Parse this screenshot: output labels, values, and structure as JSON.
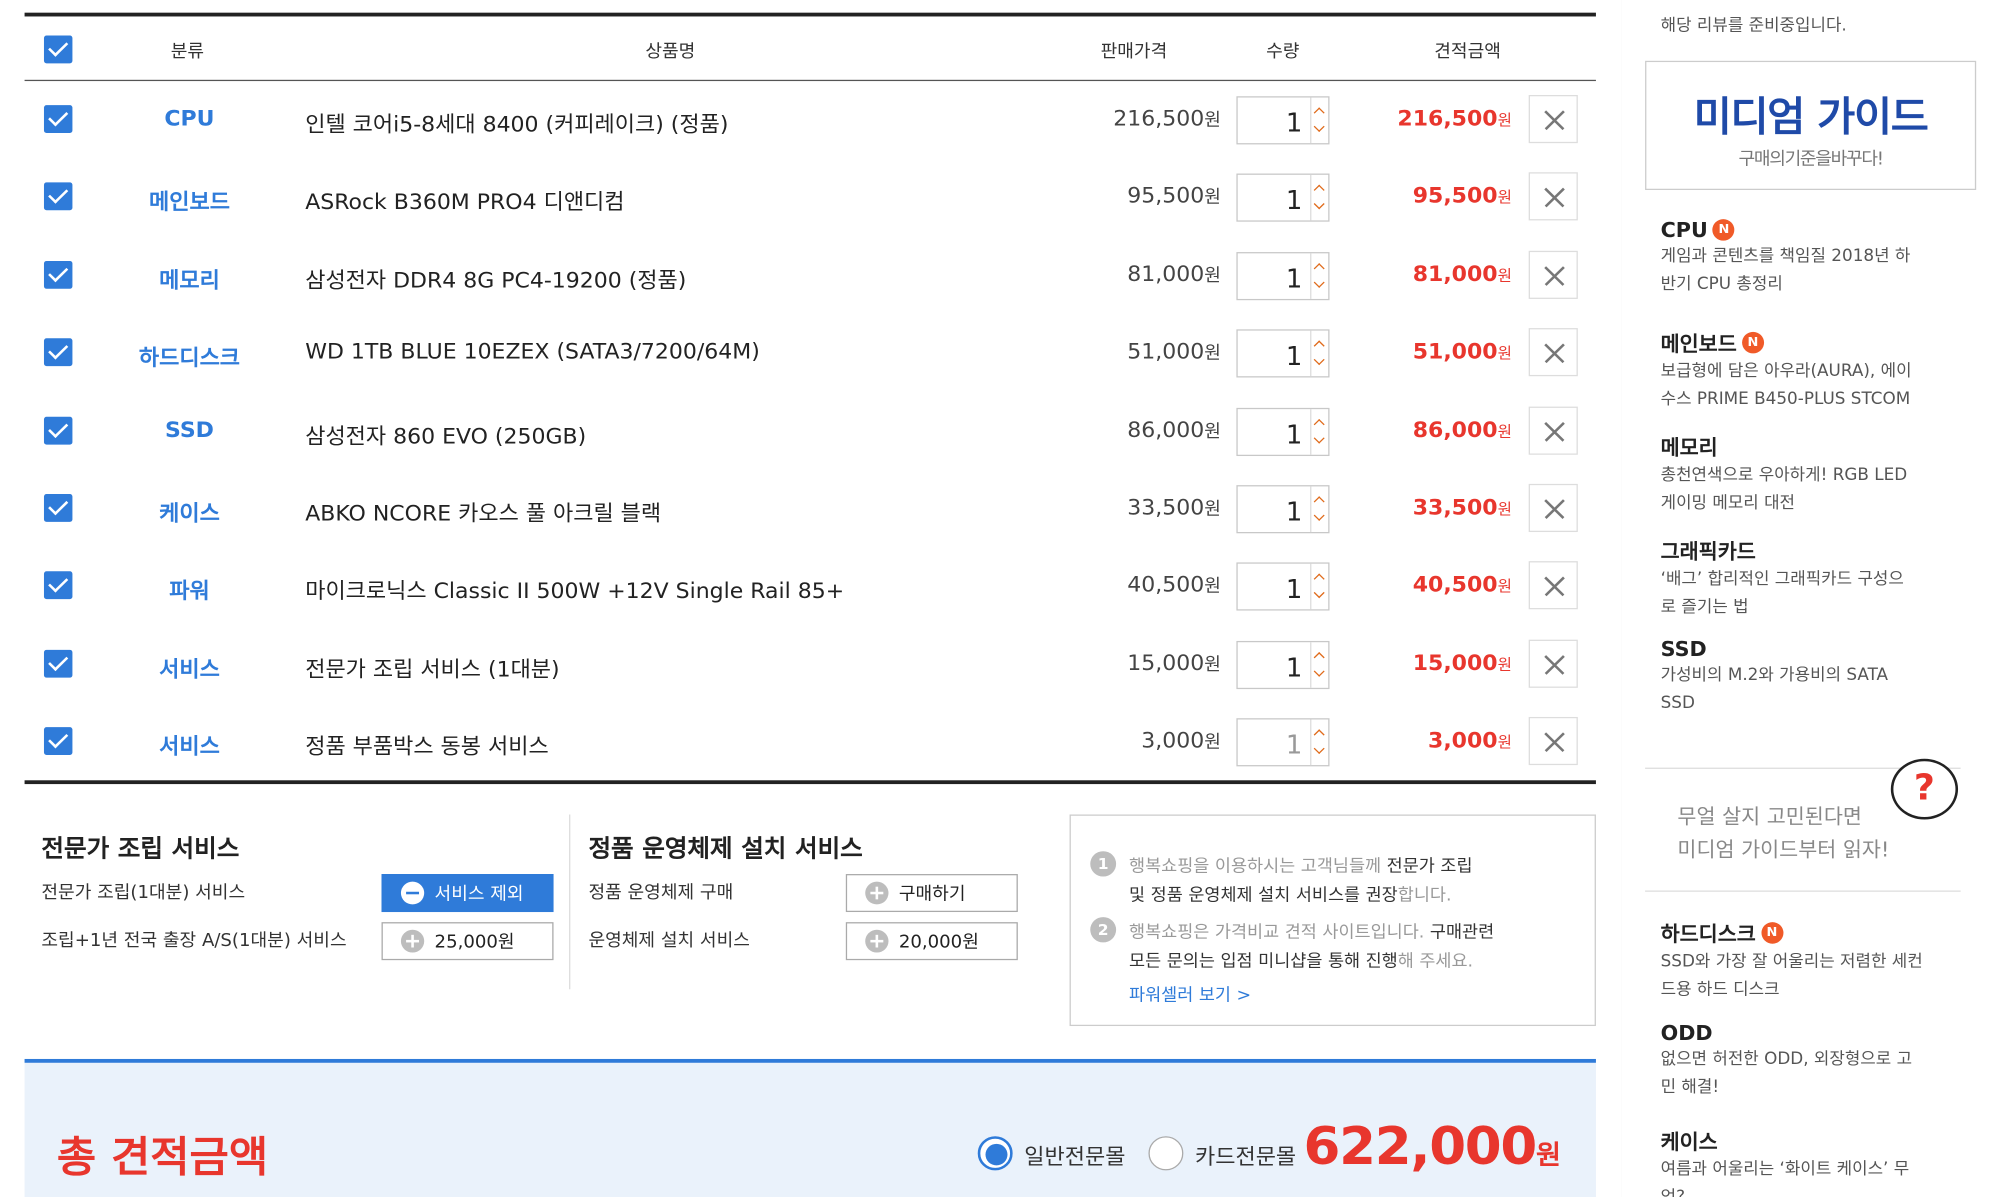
{
  "table": {
    "headers": {
      "category": "분류",
      "product": "상품명",
      "price": "판매가격",
      "qty": "수량",
      "estimate": "견적금액"
    },
    "currency_unit": "원",
    "rows": [
      {
        "category": "CPU",
        "name": "인텔 코어i5-8세대 8400 (커피레이크) (정품)",
        "price": "216,500",
        "qty": "1",
        "total": "216,500"
      },
      {
        "category": "메인보드",
        "name": "ASRock B360M PRO4 디앤디컴",
        "price": "95,500",
        "qty": "1",
        "total": "95,500"
      },
      {
        "category": "메모리",
        "name": "삼성전자 DDR4 8G PC4-19200 (정품)",
        "price": "81,000",
        "qty": "1",
        "total": "81,000"
      },
      {
        "category": "하드디스크",
        "name": "WD 1TB BLUE 10EZEX (SATA3/7200/64M)",
        "price": "51,000",
        "qty": "1",
        "total": "51,000"
      },
      {
        "category": "SSD",
        "name": "삼성전자 860 EVO (250GB)",
        "price": "86,000",
        "qty": "1",
        "total": "86,000"
      },
      {
        "category": "케이스",
        "name": "ABKO NCORE 카오스 풀 아크릴 블랙",
        "price": "33,500",
        "qty": "1",
        "total": "33,500"
      },
      {
        "category": "파워",
        "name": "마이크로닉스 Classic II 500W +12V Single Rail 85+",
        "price": "40,500",
        "qty": "1",
        "total": "40,500"
      },
      {
        "category": "서비스",
        "name": "전문가 조립 서비스 (1대분)",
        "price": "15,000",
        "qty": "1",
        "total": "15,000"
      },
      {
        "category": "서비스",
        "name": "정품 부품박스 동봉 서비스",
        "price": "3,000",
        "qty": "1",
        "total": "3,000"
      }
    ]
  },
  "assembly": {
    "title": "전문가 조립 서비스",
    "label1": "전문가 조립(1대분) 서비스",
    "btn1": "서비스 제외",
    "label2": "조립+1년 전국 출장 A/S(1대분) 서비스",
    "btn2": "25,000원"
  },
  "os": {
    "title": "정품 운영체제 설치 서비스",
    "label1": "정품 운영체제 구매",
    "btn1": "구매하기",
    "label2": "운영체제 설치 서비스",
    "btn2": "20,000원"
  },
  "notice": {
    "n1": "1",
    "l1a": "행복쇼핑을 이용하시는 고객님들께 ",
    "l1b": "전문가 조립",
    "l2": "및 정품 운영체제 설치 서비스를 권장",
    "l2b": "합니다.",
    "n2": "2",
    "l3a": "행복쇼핑은 가격비교 견적 사이트입니다. ",
    "l3b": "구매관련",
    "l4": "모든 문의는 입점 미니샵을 통해 진행",
    "l4b": "해 주세요.",
    "link": "파워셀러 보기 >"
  },
  "total": {
    "label": "총 견적금액",
    "radio1": "일반전문몰",
    "radio2": "카드전문몰",
    "amount": "622,000",
    "unit": "원"
  },
  "sidebar": {
    "top_text": "해당 리뷰를 준비중입니다.",
    "guide_title": "미디엄 가이드",
    "guide_sub": "구매의기준을바꾸다!",
    "items": [
      {
        "title": "CPU",
        "new": "N",
        "desc1": "게임과 콘텐츠를 책임질 2018년 하",
        "desc2": "반기 CPU 총정리"
      },
      {
        "title": "메인보드",
        "new": "N",
        "desc1": "보급형에 담은 아우라(AURA), 에이",
        "desc2": "수스 PRIME B450-PLUS STCOM"
      },
      {
        "title": "메모리",
        "new": "",
        "desc1": "총천연색으로 우아하게! RGB LED",
        "desc2": "게이밍 메모리 대전"
      },
      {
        "title": "그래픽카드",
        "new": "",
        "desc1": "‘배그’ 합리적인 그래픽카드 구성으",
        "desc2": "로 즐기는 법"
      },
      {
        "title": "SSD",
        "new": "",
        "desc1": "가성비의 M.2와 가용비의 SATA",
        "desc2": "SSD"
      },
      {
        "title": "하드디스크",
        "new": "N",
        "desc1": "SSD와 가장 잘 어울리는 저렴한 세컨",
        "desc2": "드용 하드 디스크"
      },
      {
        "title": "ODD",
        "new": "",
        "desc1": "없으면 허전한 ODD, 외장형으로 고",
        "desc2": "민 해결!"
      },
      {
        "title": "케이스",
        "new": "",
        "desc1": "여름과 어울리는 ‘화이트 케이스’ 무",
        "desc2": "엇?"
      }
    ],
    "question1": "무얼 살지 고민된다면",
    "question2": "미디엄 가이드부터 읽자!",
    "question_icon": "?"
  },
  "colors": {
    "accent": "#2f7bd9",
    "price_red": "#e8362d",
    "brand_navy": "#1f4aa8"
  }
}
